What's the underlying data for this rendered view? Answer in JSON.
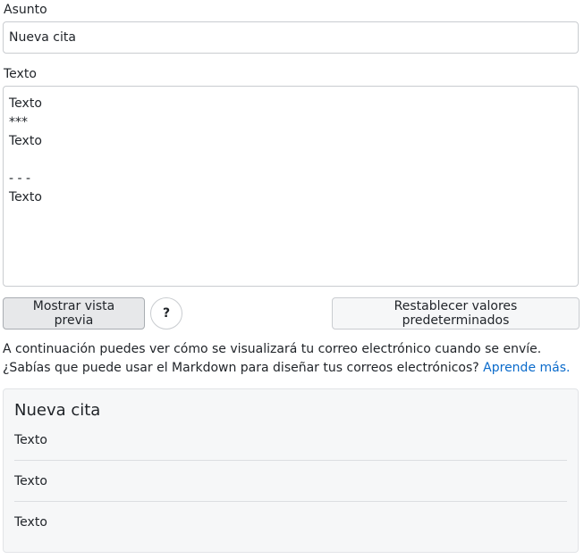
{
  "form": {
    "subject_label": "Asunto",
    "subject_value": "Nueva cita",
    "body_label": "Texto",
    "body_value": "Texto\n***\nTexto\n\n- - -\nTexto"
  },
  "actions": {
    "preview_label": "Mostrar vista previa",
    "help_label": "?",
    "reset_label": "Restablecer valores predeterminados"
  },
  "info": {
    "text": "A continuación puedes ver cómo se visualizará tu correo electrónico cuando se envíe. ¿Sabías que puede usar el Markdown para diseñar tus correos electrónicos? ",
    "link": "Aprende más."
  },
  "preview": {
    "title": "Nueva cita",
    "paragraphs": [
      "Texto",
      "Texto",
      "Texto"
    ]
  },
  "colors": {
    "link": "#0b6bcb",
    "preview_background": "#f6f7f8"
  }
}
